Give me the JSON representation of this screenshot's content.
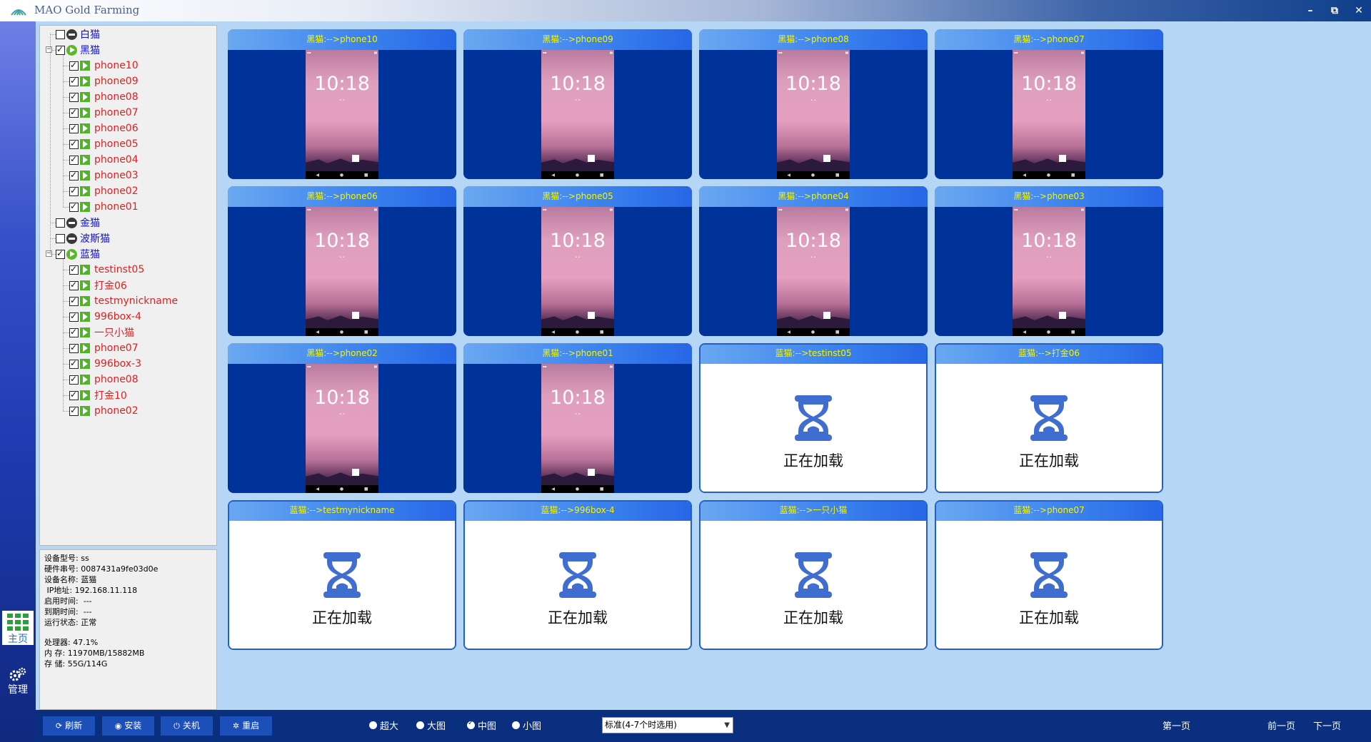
{
  "window": {
    "title": "MAO Gold Farming",
    "controls": {
      "minimize": "–",
      "restore": "⧉",
      "close": "✕"
    }
  },
  "nav": {
    "items": [
      {
        "label": "主页",
        "icon": "grid-icon",
        "active": true
      },
      {
        "label": "管理",
        "icon": "gears-icon",
        "active": false
      }
    ]
  },
  "tree": {
    "groups": [
      {
        "label": "白猫",
        "checked": false,
        "state": "stopped",
        "expanded": false,
        "children": []
      },
      {
        "label": "黑猫",
        "checked": true,
        "state": "running",
        "expanded": true,
        "children": [
          "phone10",
          "phone09",
          "phone08",
          "phone07",
          "phone06",
          "phone05",
          "phone04",
          "phone03",
          "phone02",
          "phone01"
        ]
      },
      {
        "label": "金猫",
        "checked": false,
        "state": "stopped",
        "expanded": false,
        "children": []
      },
      {
        "label": "波斯猫",
        "checked": false,
        "state": "stopped",
        "expanded": false,
        "children": []
      },
      {
        "label": "蓝猫",
        "checked": true,
        "state": "running",
        "expanded": true,
        "children": [
          "testinst05",
          "打金06",
          "testmynickname",
          "996box-4",
          "一只小猫",
          "phone07",
          "996box-3",
          "phone08",
          "打金10",
          "phone02"
        ]
      }
    ]
  },
  "info": {
    "model_label": "设备型号:",
    "model": "ss",
    "serial_label": "硬件串号:",
    "serial": "0087431a9fe03d0e",
    "name_label": "设备名称:",
    "name": "蓝猫",
    "ip_label": "IP地址:",
    "ip": "192.168.11.118",
    "start_label": "启用时间:",
    "start": "---",
    "expire_label": "到期时间:",
    "expire": "---",
    "status_label": "运行状态:",
    "status": "正常",
    "cpu_label": "处理器:",
    "cpu": "47.1%",
    "mem_label": "内  存:",
    "mem": "11970MB/15882MB",
    "disk_label": "存  储:",
    "disk": "55G/114G"
  },
  "cards": [
    {
      "title": "黑猫:-->phone10",
      "loading": false
    },
    {
      "title": "黑猫:-->phone09",
      "loading": false
    },
    {
      "title": "黑猫:-->phone08",
      "loading": false
    },
    {
      "title": "黑猫:-->phone07",
      "loading": false
    },
    {
      "title": "黑猫:-->phone06",
      "loading": false
    },
    {
      "title": "黑猫:-->phone05",
      "loading": false
    },
    {
      "title": "黑猫:-->phone04",
      "loading": false
    },
    {
      "title": "黑猫:-->phone03",
      "loading": false
    },
    {
      "title": "黑猫:-->phone02",
      "loading": false
    },
    {
      "title": "黑猫:-->phone01",
      "loading": false
    },
    {
      "title": "蓝猫:-->testinst05",
      "loading": true
    },
    {
      "title": "蓝猫:-->打金06",
      "loading": true
    },
    {
      "title": "蓝猫:-->testmynickname",
      "loading": true
    },
    {
      "title": "蓝猫:-->996box-4",
      "loading": true
    },
    {
      "title": "蓝猫:-->一只小猫",
      "loading": true
    },
    {
      "title": "蓝猫:-->phone07",
      "loading": true
    }
  ],
  "screen": {
    "clock": "10:18"
  },
  "loading_text": "正在加载",
  "toolbar": {
    "refresh": "刷新",
    "install": "安装",
    "shutdown": "关机",
    "reboot": "重启",
    "sizes": [
      {
        "label": "超大",
        "selected": false
      },
      {
        "label": "大图",
        "selected": false
      },
      {
        "label": "中图",
        "selected": true
      },
      {
        "label": "小图",
        "selected": false
      }
    ],
    "select_value": "标准(4-7个时选用)",
    "first_page": "第一页",
    "prev_page": "前一页",
    "next_page": "下一页"
  },
  "colors": {
    "card_bg": "#003399",
    "card_header": "#3b82ee",
    "card_title_text": "#f6f600",
    "tree_group_text": "#1010e0",
    "tree_item_text": "#e02020",
    "bottom_bar": "#0a2f7e"
  }
}
